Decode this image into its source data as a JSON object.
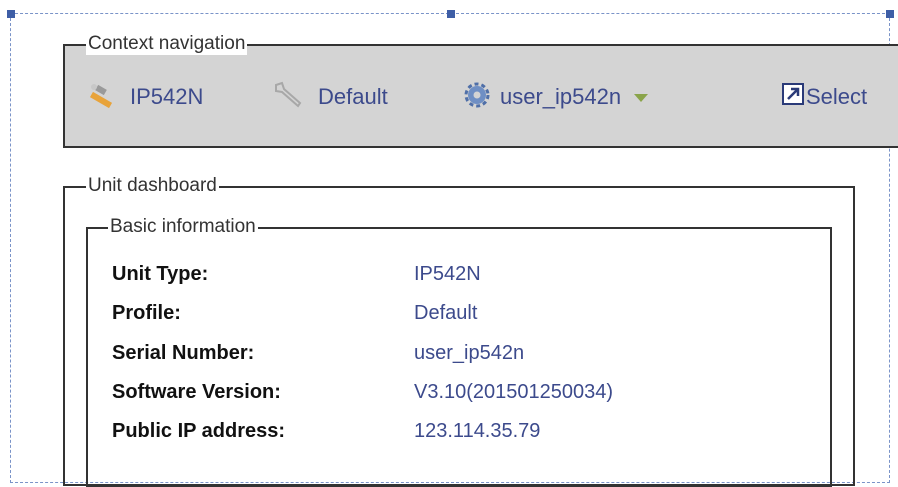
{
  "context_navigation": {
    "legend": "Context navigation",
    "items": [
      {
        "label": "IP542N",
        "icon": "unit-icon"
      },
      {
        "label": "Default",
        "icon": "wrench-icon"
      },
      {
        "label": "user_ip542n",
        "icon": "gear-icon"
      },
      {
        "label": "Select",
        "icon": "external-link-icon"
      }
    ]
  },
  "unit_dashboard": {
    "legend": "Unit dashboard",
    "basic_information": {
      "legend": "Basic information",
      "rows": [
        {
          "label": "Unit Type:",
          "value": "IP542N"
        },
        {
          "label": "Profile:",
          "value": "Default"
        },
        {
          "label": "Serial Number:",
          "value": "user_ip542n"
        },
        {
          "label": "Software Version:",
          "value": "V3.10(201501250034)"
        },
        {
          "label": "Public IP address:",
          "value": "123.114.35.79"
        }
      ]
    }
  },
  "colors": {
    "link": "#3c4a8c",
    "nav_bar": "#d4d4d4",
    "selection": "#3e5ea6"
  }
}
